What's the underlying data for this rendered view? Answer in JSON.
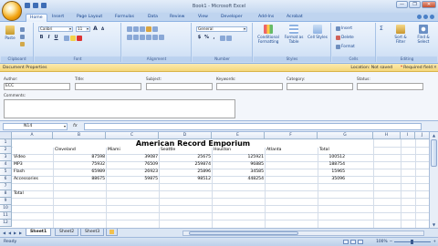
{
  "window": {
    "title": "Book1 - Microsoft Excel",
    "controls": [
      "—",
      "❐",
      "✕"
    ]
  },
  "tabs": [
    "Home",
    "Insert",
    "Page Layout",
    "Formulas",
    "Data",
    "Review",
    "View",
    "Developer",
    "Add-Ins",
    "Acrobat"
  ],
  "active_tab": "Home",
  "ribbon": {
    "clipboard": {
      "label": "Clipboard",
      "paste": "Paste"
    },
    "font": {
      "label": "Font",
      "family": "Calibri",
      "size": "11",
      "bold": "B",
      "italic": "I",
      "underline": "U"
    },
    "alignment": {
      "label": "Alignment"
    },
    "number": {
      "label": "Number",
      "format": "General",
      "currency": "$",
      "percent": "%",
      "comma": ","
    },
    "styles": {
      "label": "Styles",
      "conditional": "Conditional Formatting",
      "format_table": "Format as Table",
      "cell_styles": "Cell Styles"
    },
    "cells": {
      "label": "Cells",
      "insert": "Insert",
      "delete": "Delete",
      "format": "Format"
    },
    "editing": {
      "label": "Editing",
      "sort": "Sort & Filter",
      "find": "Find & Select",
      "sigma": "Σ"
    }
  },
  "doc_properties": {
    "title": "Document Properties",
    "location": "Location: Not saved",
    "required": "Required field",
    "fields": {
      "author": {
        "label": "Author:",
        "value": "ECC"
      },
      "title": {
        "label": "Title:",
        "value": ""
      },
      "subject": {
        "label": "Subject:",
        "value": ""
      },
      "keywords": {
        "label": "Keywords:",
        "value": ""
      },
      "category": {
        "label": "Category:",
        "value": ""
      },
      "status": {
        "label": "Status:",
        "value": ""
      },
      "comments": {
        "label": "Comments:",
        "value": ""
      }
    }
  },
  "formula_bar": {
    "name_box": "N14",
    "fx": "fx",
    "formula": ""
  },
  "columns": [
    "A",
    "B",
    "C",
    "D",
    "E",
    "F",
    "G",
    "H",
    "I",
    "J"
  ],
  "rows": [
    "1",
    "2",
    "3",
    "4",
    "5",
    "6",
    "7",
    "8",
    "9",
    "10",
    "11",
    "12"
  ],
  "sheet": {
    "title": "American Record Emporium",
    "headers": [
      "Cleveland",
      "Miami",
      "Seattle",
      "Houston",
      "Atlanta",
      "Total"
    ],
    "data": [
      {
        "label": "Video",
        "values": [
          "87598",
          "39087",
          "25675",
          "125921",
          "",
          "100512"
        ]
      },
      {
        "label": "MP3",
        "values": [
          "75932",
          "76509",
          "259874",
          "96885",
          "",
          "188754"
        ]
      },
      {
        "label": "Flash",
        "values": [
          "65989",
          "26923",
          "25896",
          "34585",
          "",
          "15965"
        ]
      },
      {
        "label": "Accessories",
        "values": [
          "88675",
          "59875",
          "98512",
          "448254",
          "",
          "35096"
        ]
      }
    ],
    "total_label": "Total"
  },
  "sheet_tabs": [
    "Sheet1",
    "Sheet2",
    "Sheet3"
  ],
  "active_sheet": "Sheet1",
  "status": {
    "mode": "Ready",
    "zoom": "100%"
  }
}
